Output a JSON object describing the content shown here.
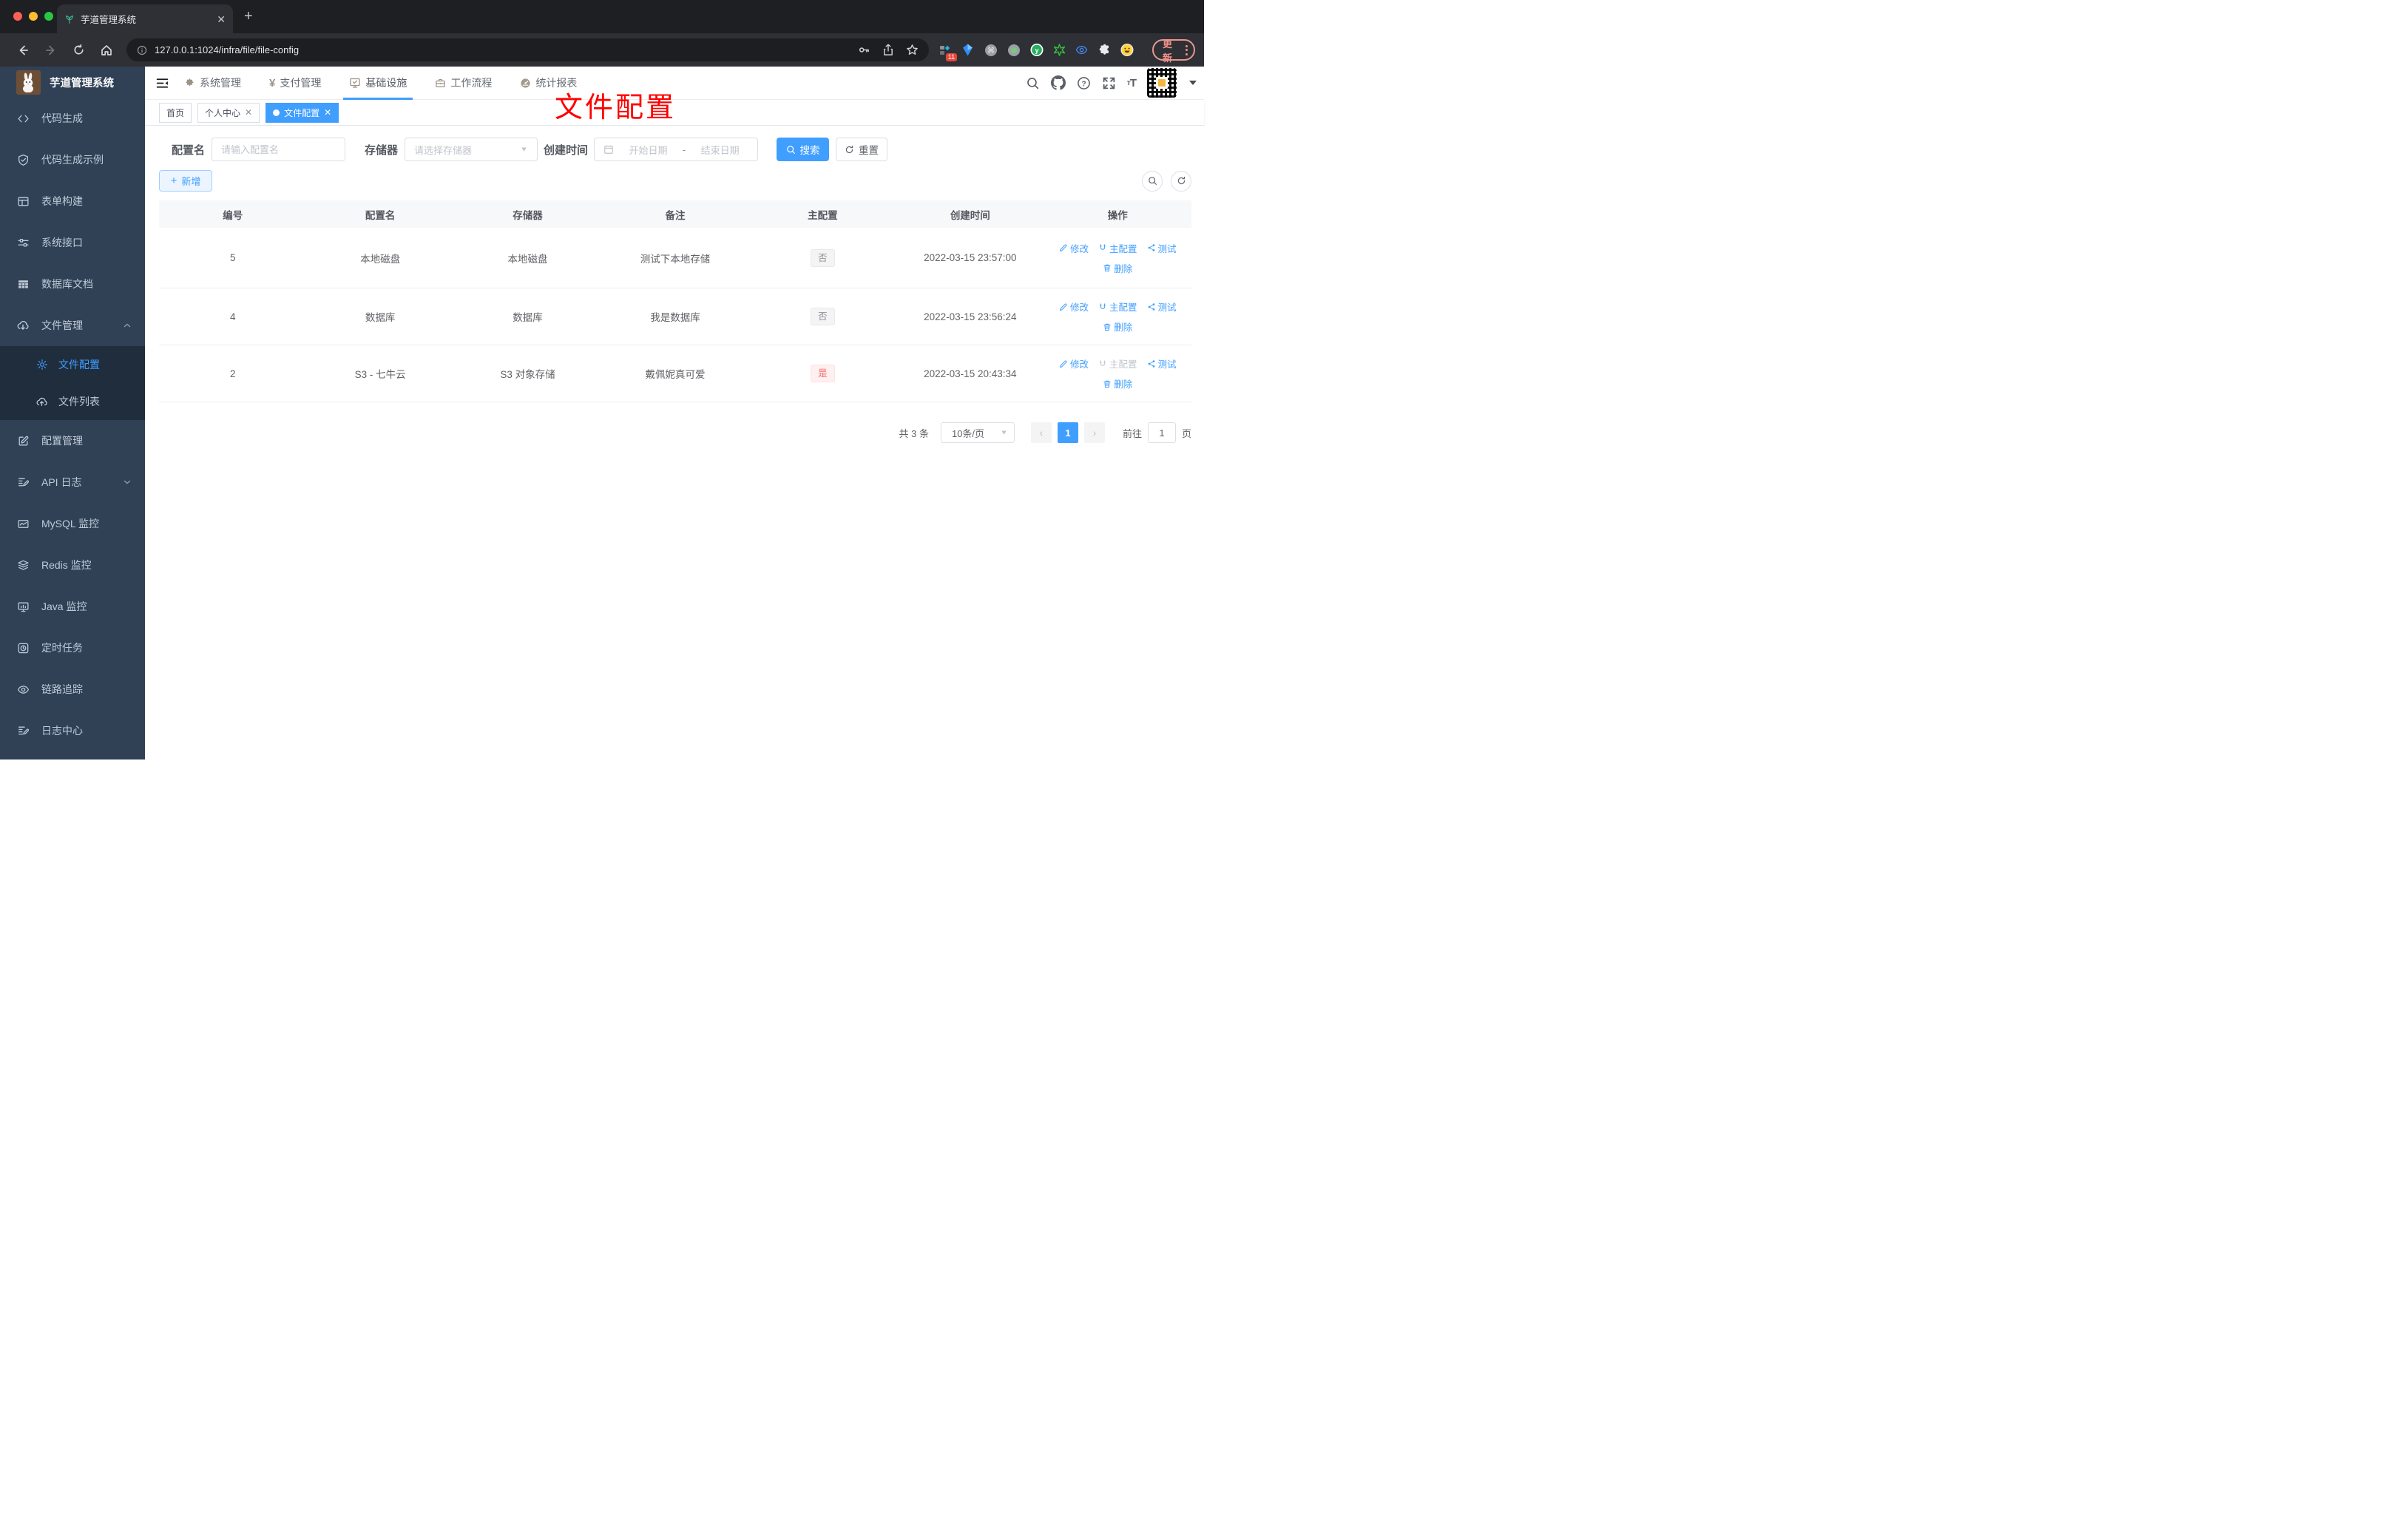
{
  "browser": {
    "tab_title": "芋道管理系统",
    "url": "127.0.0.1:1024/infra/file/file-config",
    "update_label": "更新",
    "extension_badge": "11"
  },
  "sidebar": {
    "logo_title": "芋道管理系统",
    "items": [
      {
        "label": "代码生成",
        "icon": "code-icon"
      },
      {
        "label": "代码生成示例",
        "icon": "shield-check-icon"
      },
      {
        "label": "表单构建",
        "icon": "form-builder-icon"
      },
      {
        "label": "系统接口",
        "icon": "sliders-icon"
      },
      {
        "label": "数据库文档",
        "icon": "table-grid-icon"
      },
      {
        "label": "文件管理",
        "icon": "cloud-download-icon",
        "expanded": true
      },
      {
        "label": "文件配置",
        "icon": "gear-icon",
        "active": true
      },
      {
        "label": "文件列表",
        "icon": "cloud-upload-icon"
      },
      {
        "label": "配置管理",
        "icon": "edit-square-icon"
      },
      {
        "label": "API 日志",
        "icon": "document-log-icon",
        "collapsed": true
      },
      {
        "label": "MySQL 监控",
        "icon": "chart-line-icon"
      },
      {
        "label": "Redis 监控",
        "icon": "layers-icon"
      },
      {
        "label": "Java 监控",
        "icon": "monitor-icon"
      },
      {
        "label": "定时任务",
        "icon": "timer-icon"
      },
      {
        "label": "链路追踪",
        "icon": "eye-icon"
      },
      {
        "label": "日志中心",
        "icon": "log-edit-icon"
      }
    ]
  },
  "topnav": {
    "items": [
      {
        "label": "系统管理",
        "icon": "gear-icon"
      },
      {
        "label": "支付管理",
        "icon": "yen-icon"
      },
      {
        "label": "基础设施",
        "icon": "monitor-check-icon",
        "active": true
      },
      {
        "label": "工作流程",
        "icon": "briefcase-icon"
      },
      {
        "label": "统计报表",
        "icon": "gauge-icon"
      }
    ]
  },
  "tags": {
    "items": [
      {
        "label": "首页"
      },
      {
        "label": "个人中心",
        "closable": true
      },
      {
        "label": "文件配置",
        "active": true,
        "closable": true
      }
    ]
  },
  "annotation": {
    "text": "文件配置",
    "color": "#ff0000"
  },
  "filters": {
    "name_label": "配置名",
    "name_placeholder": "请输入配置名",
    "storage_label": "存储器",
    "storage_placeholder": "请选择存储器",
    "date_label": "创建时间",
    "date_start_placeholder": "开始日期",
    "date_separator": "-",
    "date_end_placeholder": "结束日期",
    "search_label": "搜索",
    "reset_label": "重置"
  },
  "toolbar": {
    "add_label": "新增"
  },
  "table": {
    "columns": [
      "编号",
      "配置名",
      "存储器",
      "备注",
      "主配置",
      "创建时间",
      "操作"
    ],
    "actions": {
      "edit": "修改",
      "master": "主配置",
      "test": "测试",
      "delete": "删除"
    },
    "rows": [
      {
        "id": "5",
        "name": "本地磁盘",
        "storage": "本地磁盘",
        "remark": "测试下本地存储",
        "master": "否",
        "created": "2022-03-15 23:57:00"
      },
      {
        "id": "4",
        "name": "数据库",
        "storage": "数据库",
        "remark": "我是数据库",
        "master": "否",
        "created": "2022-03-15 23:56:24"
      },
      {
        "id": "2",
        "name": "S3 - 七牛云",
        "storage": "S3 对象存储",
        "remark": "戴佩妮真可爱",
        "master": "是",
        "created": "2022-03-15 20:43:34"
      }
    ]
  },
  "pagination": {
    "total": "共 3 条",
    "page_size": "10条/页",
    "current_page": "1",
    "goto_label": "前往",
    "goto_value": "1",
    "page_unit": "页"
  },
  "colors": {
    "accent": "#409eff",
    "sidebar_bg": "#304156",
    "submenu_bg": "#1f2d3d",
    "danger": "#f56c6c",
    "annotation": "#ff0000"
  }
}
